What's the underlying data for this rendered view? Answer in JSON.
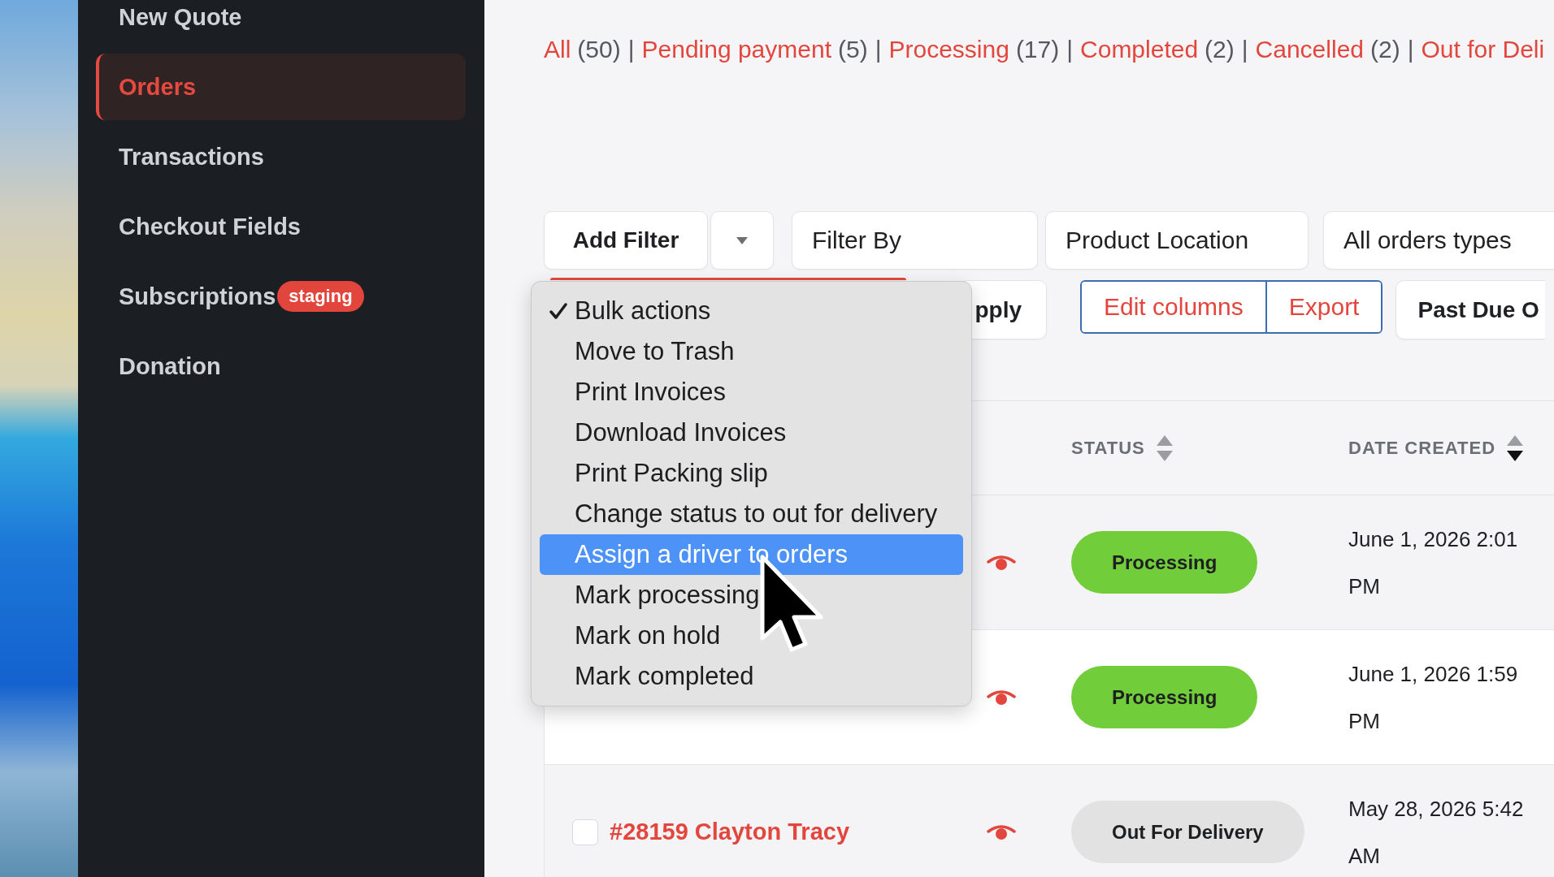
{
  "sidebar": {
    "items": [
      {
        "label": "New Quote",
        "selected": false
      },
      {
        "label": "Orders",
        "selected": true
      },
      {
        "label": "Transactions",
        "selected": false
      },
      {
        "label": "Checkout Fields",
        "selected": false
      },
      {
        "label": "Subscriptions",
        "selected": false,
        "badge": "staging"
      },
      {
        "label": "Donation",
        "selected": false
      }
    ]
  },
  "status_filters": [
    {
      "label": "All",
      "count": "(50)",
      "separator": "|"
    },
    {
      "label": "Pending payment",
      "count": "(5)",
      "separator": "|"
    },
    {
      "label": "Processing",
      "count": "(17)",
      "separator": "|"
    },
    {
      "label": "Completed",
      "count": "(2)",
      "separator": "|"
    },
    {
      "label": "Cancelled",
      "count": "(2)",
      "separator": "|"
    },
    {
      "label": "Out for Deli"
    }
  ],
  "toolbar": {
    "add_filter": {
      "label": "Add Filter"
    },
    "filters": [
      {
        "value": "Filter By"
      },
      {
        "value": "Product Location"
      },
      {
        "value": "All orders types"
      }
    ],
    "bulk_actions": {
      "open": true,
      "options": [
        {
          "label": "Bulk actions",
          "checked": true,
          "highlighted": false
        },
        {
          "label": "Move to Trash",
          "checked": false,
          "highlighted": false
        },
        {
          "label": "Print Invoices",
          "checked": false,
          "highlighted": false
        },
        {
          "label": "Download Invoices",
          "checked": false,
          "highlighted": false
        },
        {
          "label": "Print Packing slip",
          "checked": false,
          "highlighted": false
        },
        {
          "label": "Change status to out for delivery",
          "checked": false,
          "highlighted": false
        },
        {
          "label": "Assign a driver to orders",
          "checked": false,
          "highlighted": true
        },
        {
          "label": "Mark processing",
          "checked": false,
          "highlighted": false
        },
        {
          "label": "Mark on hold",
          "checked": false,
          "highlighted": false
        },
        {
          "label": "Mark completed",
          "checked": false,
          "highlighted": false
        }
      ]
    },
    "apply_button": {
      "label": "pply"
    },
    "column_buttons": [
      {
        "label": "Edit columns"
      },
      {
        "label": "Export"
      }
    ],
    "past_due_button": {
      "label": "Past Due O"
    }
  },
  "table": {
    "columns": [
      {
        "label": "STATUS",
        "sorted_descending": false
      },
      {
        "label": "DATE CREATED",
        "sorted_descending": true
      }
    ],
    "rows": [
      {
        "status": {
          "label": "Processing",
          "color": "#72cd3a"
        },
        "date": "June 1, 2026 2:01 PM"
      },
      {
        "status": {
          "label": "Processing",
          "color": "#72cd3a"
        },
        "date": "June 1, 2026 1:59 PM"
      },
      {
        "checked": false,
        "order": "#28159 Clayton Tracy",
        "status": {
          "label": "Out For Delivery",
          "color": "#e2e2e2"
        },
        "date": "May 28, 2026 5:42 AM"
      }
    ]
  }
}
